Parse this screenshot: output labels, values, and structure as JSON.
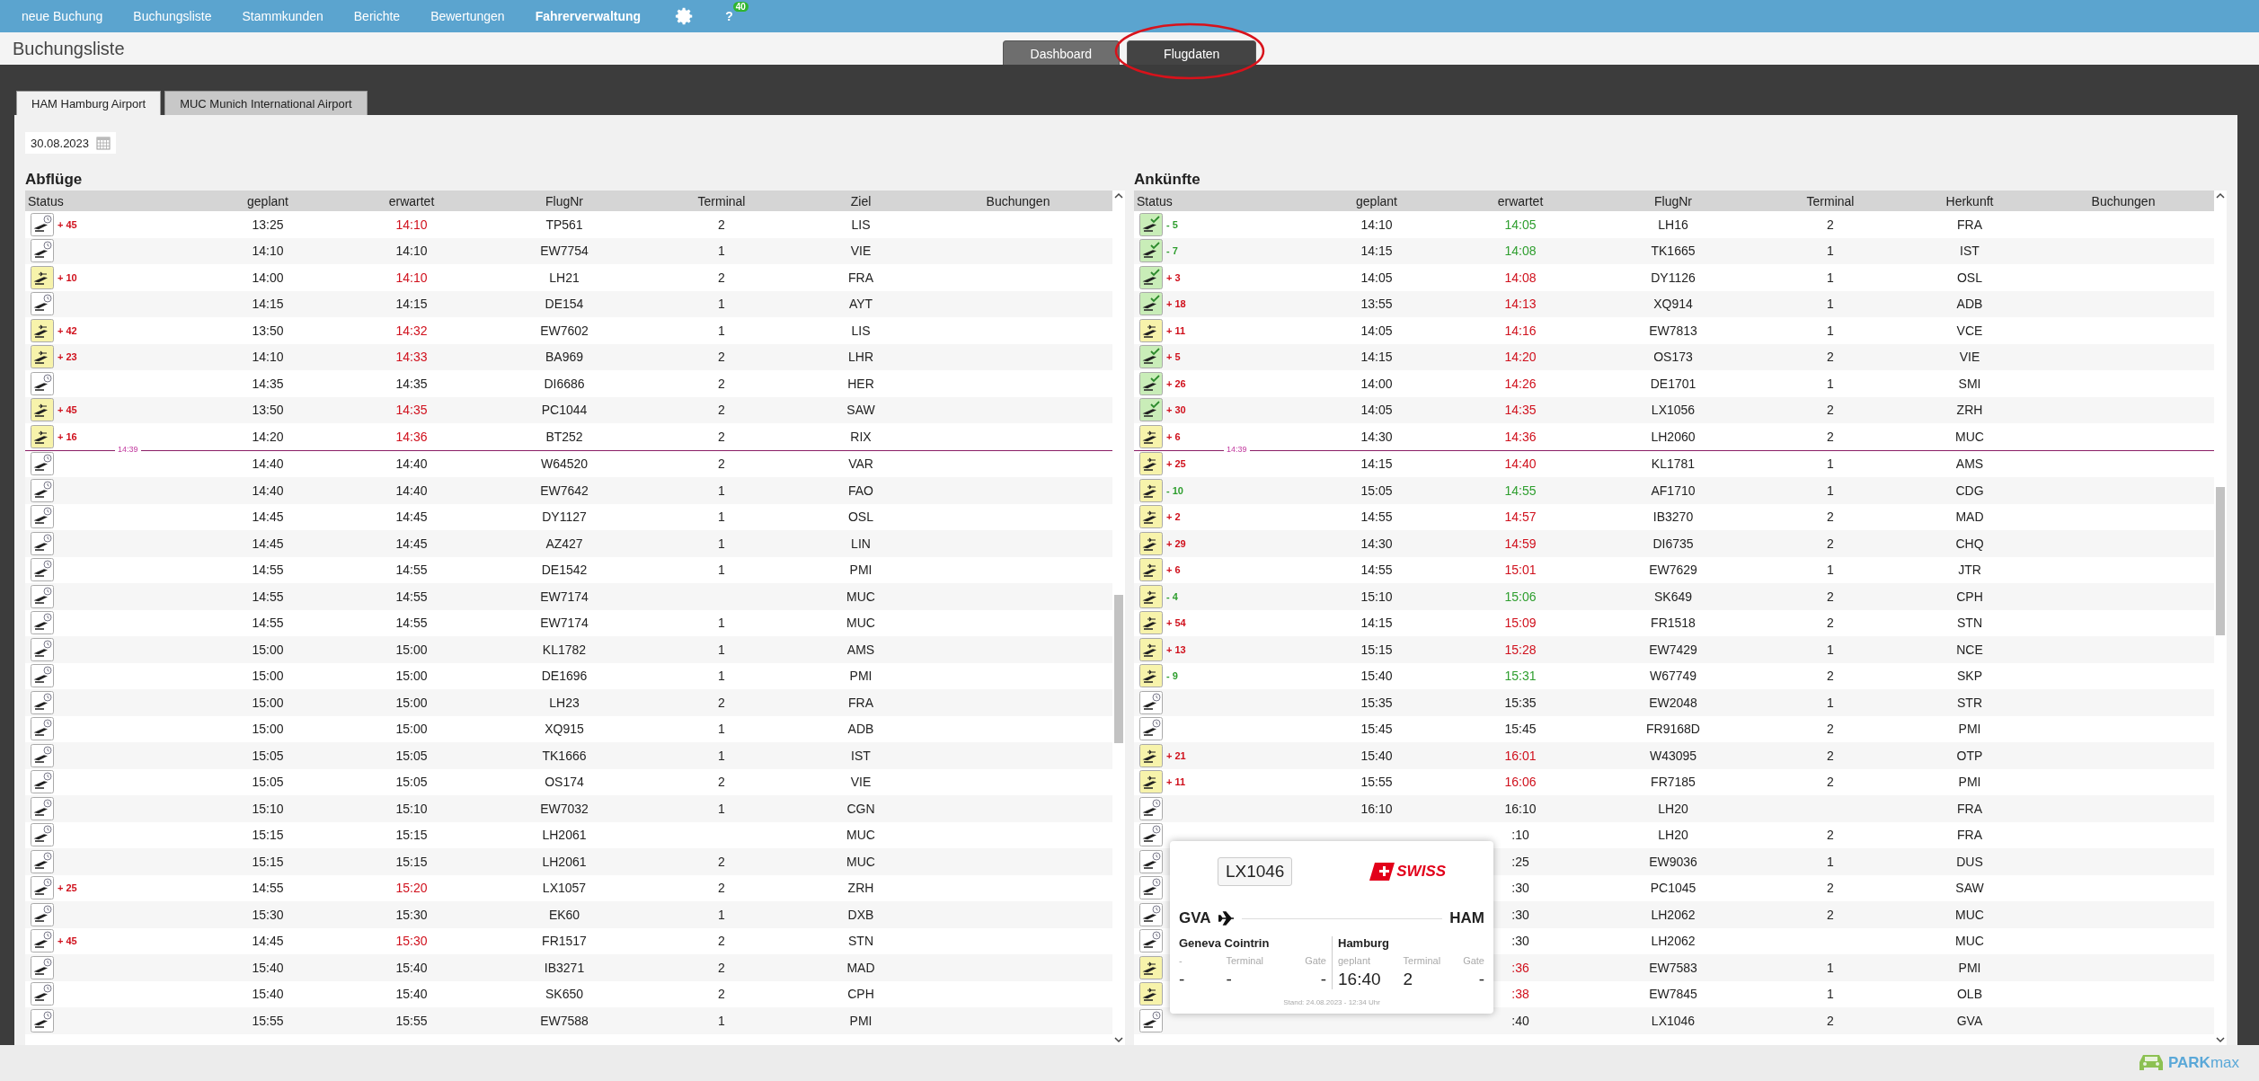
{
  "nav": {
    "items": [
      {
        "label": "neue Buchung",
        "selected": false
      },
      {
        "label": "Buchungsliste",
        "selected": false
      },
      {
        "label": "Stammkunden",
        "selected": false
      },
      {
        "label": "Berichte",
        "selected": false
      },
      {
        "label": "Bewertungen",
        "selected": false
      },
      {
        "label": "Fahrerverwaltung",
        "selected": true
      }
    ],
    "help": "?",
    "badge": "40"
  },
  "page_title": "Buchungsliste",
  "view_tabs": [
    {
      "label": "Dashboard",
      "selected": false,
      "highlighted": false
    },
    {
      "label": "Flugdaten",
      "selected": true,
      "highlighted": true
    }
  ],
  "airport_tabs": [
    {
      "label": "HAM Hamburg Airport",
      "selected": true
    },
    {
      "label": "MUC Munich International Airport",
      "selected": false
    }
  ],
  "date": "30.08.2023",
  "departures": {
    "title": "Abflüge",
    "columns": [
      "Status",
      "geplant",
      "erwartet",
      "FlugNr",
      "Terminal",
      "Ziel",
      "Buchungen"
    ],
    "rows": [
      {
        "kind": "flight",
        "icon": {
          "kind": "scheduled"
        },
        "delay": "+ 45",
        "late": true,
        "early": false,
        "planned": "13:25",
        "expected": "14:10",
        "flight": "TP561",
        "terminal": "2",
        "place": "LIS"
      },
      {
        "kind": "flight",
        "icon": {
          "kind": "scheduled"
        },
        "late": false,
        "early": false,
        "planned": "14:10",
        "expected": "14:10",
        "flight": "EW7754",
        "terminal": "1",
        "place": "VIE"
      },
      {
        "kind": "flight",
        "icon": {
          "kind": "airborne"
        },
        "delay": "+ 10",
        "late": true,
        "early": false,
        "planned": "14:00",
        "expected": "14:10",
        "flight": "LH21",
        "terminal": "2",
        "place": "FRA"
      },
      {
        "kind": "flight",
        "icon": {
          "kind": "scheduled"
        },
        "late": false,
        "early": false,
        "planned": "14:15",
        "expected": "14:15",
        "flight": "DE154",
        "terminal": "1",
        "place": "AYT"
      },
      {
        "kind": "flight",
        "icon": {
          "kind": "airborne"
        },
        "delay": "+ 42",
        "late": true,
        "early": false,
        "planned": "13:50",
        "expected": "14:32",
        "flight": "EW7602",
        "terminal": "1",
        "place": "LIS"
      },
      {
        "kind": "flight",
        "icon": {
          "kind": "airborne"
        },
        "delay": "+ 23",
        "late": true,
        "early": false,
        "planned": "14:10",
        "expected": "14:33",
        "flight": "BA969",
        "terminal": "2",
        "place": "LHR"
      },
      {
        "kind": "flight",
        "icon": {
          "kind": "scheduled"
        },
        "late": false,
        "early": false,
        "planned": "14:35",
        "expected": "14:35",
        "flight": "DI6686",
        "terminal": "2",
        "place": "HER"
      },
      {
        "kind": "flight",
        "icon": {
          "kind": "airborne"
        },
        "delay": "+ 45",
        "late": true,
        "early": false,
        "planned": "13:50",
        "expected": "14:35",
        "flight": "PC1044",
        "terminal": "2",
        "place": "SAW"
      },
      {
        "kind": "flight",
        "icon": {
          "kind": "airborne"
        },
        "delay": "+ 16",
        "late": true,
        "early": false,
        "planned": "14:20",
        "expected": "14:36",
        "flight": "BT252",
        "terminal": "2",
        "place": "RIX"
      },
      {
        "kind": "now",
        "time": "14:39"
      },
      {
        "kind": "flight",
        "icon": {
          "kind": "scheduled"
        },
        "late": false,
        "early": false,
        "planned": "14:40",
        "expected": "14:40",
        "flight": "W64520",
        "terminal": "2",
        "place": "VAR"
      },
      {
        "kind": "flight",
        "icon": {
          "kind": "scheduled"
        },
        "late": false,
        "early": false,
        "planned": "14:40",
        "expected": "14:40",
        "flight": "EW7642",
        "terminal": "1",
        "place": "FAO"
      },
      {
        "kind": "flight",
        "icon": {
          "kind": "scheduled"
        },
        "late": false,
        "early": false,
        "planned": "14:45",
        "expected": "14:45",
        "flight": "DY1127",
        "terminal": "1",
        "place": "OSL"
      },
      {
        "kind": "flight",
        "icon": {
          "kind": "scheduled"
        },
        "late": false,
        "early": false,
        "planned": "14:45",
        "expected": "14:45",
        "flight": "AZ427",
        "terminal": "1",
        "place": "LIN"
      },
      {
        "kind": "flight",
        "icon": {
          "kind": "scheduled"
        },
        "late": false,
        "early": false,
        "planned": "14:55",
        "expected": "14:55",
        "flight": "DE1542",
        "terminal": "1",
        "place": "PMI"
      },
      {
        "kind": "flight",
        "icon": {
          "kind": "scheduled"
        },
        "late": false,
        "early": false,
        "planned": "14:55",
        "expected": "14:55",
        "flight": "EW7174",
        "place": "MUC"
      },
      {
        "kind": "flight",
        "icon": {
          "kind": "scheduled"
        },
        "late": false,
        "early": false,
        "planned": "14:55",
        "expected": "14:55",
        "flight": "EW7174",
        "terminal": "1",
        "place": "MUC"
      },
      {
        "kind": "flight",
        "icon": {
          "kind": "scheduled"
        },
        "late": false,
        "early": false,
        "planned": "15:00",
        "expected": "15:00",
        "flight": "KL1782",
        "terminal": "1",
        "place": "AMS"
      },
      {
        "kind": "flight",
        "icon": {
          "kind": "scheduled"
        },
        "late": false,
        "early": false,
        "planned": "15:00",
        "expected": "15:00",
        "flight": "DE1696",
        "terminal": "1",
        "place": "PMI"
      },
      {
        "kind": "flight",
        "icon": {
          "kind": "scheduled"
        },
        "late": false,
        "early": false,
        "planned": "15:00",
        "expected": "15:00",
        "flight": "LH23",
        "terminal": "2",
        "place": "FRA"
      },
      {
        "kind": "flight",
        "icon": {
          "kind": "scheduled"
        },
        "late": false,
        "early": false,
        "planned": "15:00",
        "expected": "15:00",
        "flight": "XQ915",
        "terminal": "1",
        "place": "ADB"
      },
      {
        "kind": "flight",
        "icon": {
          "kind": "scheduled"
        },
        "late": false,
        "early": false,
        "planned": "15:05",
        "expected": "15:05",
        "flight": "TK1666",
        "terminal": "1",
        "place": "IST"
      },
      {
        "kind": "flight",
        "icon": {
          "kind": "scheduled"
        },
        "late": false,
        "early": false,
        "planned": "15:05",
        "expected": "15:05",
        "flight": "OS174",
        "terminal": "2",
        "place": "VIE"
      },
      {
        "kind": "flight",
        "icon": {
          "kind": "scheduled"
        },
        "late": false,
        "early": false,
        "planned": "15:10",
        "expected": "15:10",
        "flight": "EW7032",
        "terminal": "1",
        "place": "CGN"
      },
      {
        "kind": "flight",
        "icon": {
          "kind": "scheduled"
        },
        "late": false,
        "early": false,
        "planned": "15:15",
        "expected": "15:15",
        "flight": "LH2061",
        "place": "MUC"
      },
      {
        "kind": "flight",
        "icon": {
          "kind": "scheduled"
        },
        "late": false,
        "early": false,
        "planned": "15:15",
        "expected": "15:15",
        "flight": "LH2061",
        "terminal": "2",
        "place": "MUC"
      },
      {
        "kind": "flight",
        "icon": {
          "kind": "scheduled"
        },
        "delay": "+ 25",
        "late": true,
        "early": false,
        "planned": "14:55",
        "expected": "15:20",
        "flight": "LX1057",
        "terminal": "2",
        "place": "ZRH"
      },
      {
        "kind": "flight",
        "icon": {
          "kind": "scheduled"
        },
        "late": false,
        "early": false,
        "planned": "15:30",
        "expected": "15:30",
        "flight": "EK60",
        "terminal": "1",
        "place": "DXB"
      },
      {
        "kind": "flight",
        "icon": {
          "kind": "scheduled"
        },
        "delay": "+ 45",
        "late": true,
        "early": false,
        "planned": "14:45",
        "expected": "15:30",
        "flight": "FR1517",
        "terminal": "2",
        "place": "STN"
      },
      {
        "kind": "flight",
        "icon": {
          "kind": "scheduled"
        },
        "late": false,
        "early": false,
        "planned": "15:40",
        "expected": "15:40",
        "flight": "IB3271",
        "terminal": "2",
        "place": "MAD"
      },
      {
        "kind": "flight",
        "icon": {
          "kind": "scheduled"
        },
        "late": false,
        "early": false,
        "planned": "15:40",
        "expected": "15:40",
        "flight": "SK650",
        "terminal": "2",
        "place": "CPH"
      },
      {
        "kind": "flight",
        "icon": {
          "kind": "scheduled"
        },
        "late": false,
        "early": false,
        "planned": "15:55",
        "expected": "15:55",
        "flight": "EW7588",
        "terminal": "1",
        "place": "PMI"
      }
    ]
  },
  "arrivals": {
    "title": "Ankünfte",
    "columns": [
      "Status",
      "geplant",
      "erwartet",
      "FlugNr",
      "Terminal",
      "Herkunft",
      "Buchungen"
    ],
    "rows": [
      {
        "kind": "flight",
        "icon": {
          "kind": "landed"
        },
        "delay": "- 5",
        "late": false,
        "early": true,
        "planned": "14:10",
        "expected": "14:05",
        "flight": "LH16",
        "terminal": "2",
        "place": "FRA"
      },
      {
        "kind": "flight",
        "icon": {
          "kind": "landed"
        },
        "delay": "- 7",
        "late": false,
        "early": true,
        "planned": "14:15",
        "expected": "14:08",
        "flight": "TK1665",
        "terminal": "1",
        "place": "IST"
      },
      {
        "kind": "flight",
        "icon": {
          "kind": "landed"
        },
        "delay": "+ 3",
        "late": true,
        "early": false,
        "planned": "14:05",
        "expected": "14:08",
        "flight": "DY1126",
        "terminal": "1",
        "place": "OSL"
      },
      {
        "kind": "flight",
        "icon": {
          "kind": "landed"
        },
        "delay": "+ 18",
        "late": true,
        "early": false,
        "planned": "13:55",
        "expected": "14:13",
        "flight": "XQ914",
        "terminal": "1",
        "place": "ADB"
      },
      {
        "kind": "flight",
        "icon": {
          "kind": "airborne"
        },
        "delay": "+ 11",
        "late": true,
        "early": false,
        "planned": "14:05",
        "expected": "14:16",
        "flight": "EW7813",
        "terminal": "1",
        "place": "VCE"
      },
      {
        "kind": "flight",
        "icon": {
          "kind": "landed"
        },
        "delay": "+ 5",
        "late": true,
        "early": false,
        "planned": "14:15",
        "expected": "14:20",
        "flight": "OS173",
        "terminal": "2",
        "place": "VIE"
      },
      {
        "kind": "flight",
        "icon": {
          "kind": "landed"
        },
        "delay": "+ 26",
        "late": true,
        "early": false,
        "planned": "14:00",
        "expected": "14:26",
        "flight": "DE1701",
        "terminal": "1",
        "place": "SMI"
      },
      {
        "kind": "flight",
        "icon": {
          "kind": "landed"
        },
        "delay": "+ 30",
        "late": true,
        "early": false,
        "planned": "14:05",
        "expected": "14:35",
        "flight": "LX1056",
        "terminal": "2",
        "place": "ZRH"
      },
      {
        "kind": "flight",
        "icon": {
          "kind": "airborne"
        },
        "delay": "+ 6",
        "late": true,
        "early": false,
        "planned": "14:30",
        "expected": "14:36",
        "flight": "LH2060",
        "terminal": "2",
        "place": "MUC"
      },
      {
        "kind": "now",
        "time": "14:39"
      },
      {
        "kind": "flight",
        "icon": {
          "kind": "airborne"
        },
        "delay": "+ 25",
        "late": true,
        "early": false,
        "planned": "14:15",
        "expected": "14:40",
        "flight": "KL1781",
        "terminal": "1",
        "place": "AMS"
      },
      {
        "kind": "flight",
        "icon": {
          "kind": "airborne"
        },
        "delay": "- 10",
        "late": false,
        "early": true,
        "planned": "15:05",
        "expected": "14:55",
        "flight": "AF1710",
        "terminal": "1",
        "place": "CDG"
      },
      {
        "kind": "flight",
        "icon": {
          "kind": "airborne"
        },
        "delay": "+ 2",
        "late": true,
        "early": false,
        "planned": "14:55",
        "expected": "14:57",
        "flight": "IB3270",
        "terminal": "2",
        "place": "MAD"
      },
      {
        "kind": "flight",
        "icon": {
          "kind": "airborne"
        },
        "delay": "+ 29",
        "late": true,
        "early": false,
        "planned": "14:30",
        "expected": "14:59",
        "flight": "DI6735",
        "terminal": "2",
        "place": "CHQ"
      },
      {
        "kind": "flight",
        "icon": {
          "kind": "airborne"
        },
        "delay": "+ 6",
        "late": true,
        "early": false,
        "planned": "14:55",
        "expected": "15:01",
        "flight": "EW7629",
        "terminal": "1",
        "place": "JTR"
      },
      {
        "kind": "flight",
        "icon": {
          "kind": "airborne"
        },
        "delay": "- 4",
        "late": false,
        "early": true,
        "planned": "15:10",
        "expected": "15:06",
        "flight": "SK649",
        "terminal": "2",
        "place": "CPH"
      },
      {
        "kind": "flight",
        "icon": {
          "kind": "airborne"
        },
        "delay": "+ 54",
        "late": true,
        "early": false,
        "planned": "14:15",
        "expected": "15:09",
        "flight": "FR1518",
        "terminal": "2",
        "place": "STN"
      },
      {
        "kind": "flight",
        "icon": {
          "kind": "airborne"
        },
        "delay": "+ 13",
        "late": true,
        "early": false,
        "planned": "15:15",
        "expected": "15:28",
        "flight": "EW7429",
        "terminal": "1",
        "place": "NCE"
      },
      {
        "kind": "flight",
        "icon": {
          "kind": "airborne"
        },
        "delay": "- 9",
        "late": false,
        "early": true,
        "planned": "15:40",
        "expected": "15:31",
        "flight": "W67749",
        "terminal": "2",
        "place": "SKP"
      },
      {
        "kind": "flight",
        "icon": {
          "kind": "scheduled"
        },
        "late": false,
        "early": false,
        "planned": "15:35",
        "expected": "15:35",
        "flight": "EW2048",
        "terminal": "1",
        "place": "STR"
      },
      {
        "kind": "flight",
        "icon": {
          "kind": "scheduled"
        },
        "late": false,
        "early": false,
        "planned": "15:45",
        "expected": "15:45",
        "flight": "FR9168D",
        "terminal": "2",
        "place": "PMI"
      },
      {
        "kind": "flight",
        "icon": {
          "kind": "airborne"
        },
        "delay": "+ 21",
        "late": true,
        "early": false,
        "planned": "15:40",
        "expected": "16:01",
        "flight": "W43095",
        "terminal": "2",
        "place": "OTP"
      },
      {
        "kind": "flight",
        "icon": {
          "kind": "airborne"
        },
        "delay": "+ 11",
        "late": true,
        "early": false,
        "planned": "15:55",
        "expected": "16:06",
        "flight": "FR7185",
        "terminal": "2",
        "place": "PMI"
      },
      {
        "kind": "flight",
        "icon": {
          "kind": "scheduled"
        },
        "late": false,
        "early": false,
        "planned": "16:10",
        "expected": "16:10",
        "flight": "LH20",
        "place": "FRA"
      },
      {
        "kind": "flight",
        "icon": {
          "kind": "scheduled"
        },
        "late": false,
        "early": false,
        "expected": ":10",
        "flight": "LH20",
        "terminal": "2",
        "place": "FRA"
      },
      {
        "kind": "flight",
        "icon": {
          "kind": "scheduled"
        },
        "late": false,
        "early": false,
        "expected": ":25",
        "flight": "EW9036",
        "terminal": "1",
        "place": "DUS"
      },
      {
        "kind": "flight",
        "icon": {
          "kind": "scheduled"
        },
        "late": false,
        "early": false,
        "expected": ":30",
        "flight": "PC1045",
        "terminal": "2",
        "place": "SAW"
      },
      {
        "kind": "flight",
        "icon": {
          "kind": "scheduled"
        },
        "late": false,
        "early": false,
        "expected": ":30",
        "flight": "LH2062",
        "terminal": "2",
        "place": "MUC"
      },
      {
        "kind": "flight",
        "icon": {
          "kind": "scheduled"
        },
        "late": false,
        "early": false,
        "expected": ":30",
        "flight": "LH2062",
        "place": "MUC"
      },
      {
        "kind": "flight",
        "icon": {
          "kind": "airborne"
        },
        "late": true,
        "early": false,
        "expected": ":36",
        "flight": "EW7583",
        "terminal": "1",
        "place": "PMI"
      },
      {
        "kind": "flight",
        "icon": {
          "kind": "airborne"
        },
        "late": true,
        "early": false,
        "expected": ":38",
        "flight": "EW7845",
        "terminal": "1",
        "place": "OLB"
      },
      {
        "kind": "flight",
        "icon": {
          "kind": "scheduled"
        },
        "late": false,
        "early": false,
        "expected": ":40",
        "flight": "LX1046",
        "terminal": "2",
        "place": "GVA"
      }
    ]
  },
  "flight_card": {
    "flight": "LX1046",
    "airline": "SWISS",
    "origin_code": "GVA",
    "destination_code": "HAM",
    "origin": {
      "name": "Geneva Cointrin",
      "fields": [
        {
          "label": "-",
          "value": "-"
        },
        {
          "label": "Terminal",
          "value": "-"
        },
        {
          "label": "Gate",
          "value": "-"
        }
      ]
    },
    "destination": {
      "name": "Hamburg",
      "fields": [
        {
          "label": "geplant",
          "value": "16:40"
        },
        {
          "label": "Terminal",
          "value": "2"
        },
        {
          "label": "Gate",
          "value": "-"
        }
      ]
    },
    "updated": "Stand: 24.08.2023 - 12:34 Uhr"
  },
  "footer": {
    "brand": "**PARK**max"
  }
}
